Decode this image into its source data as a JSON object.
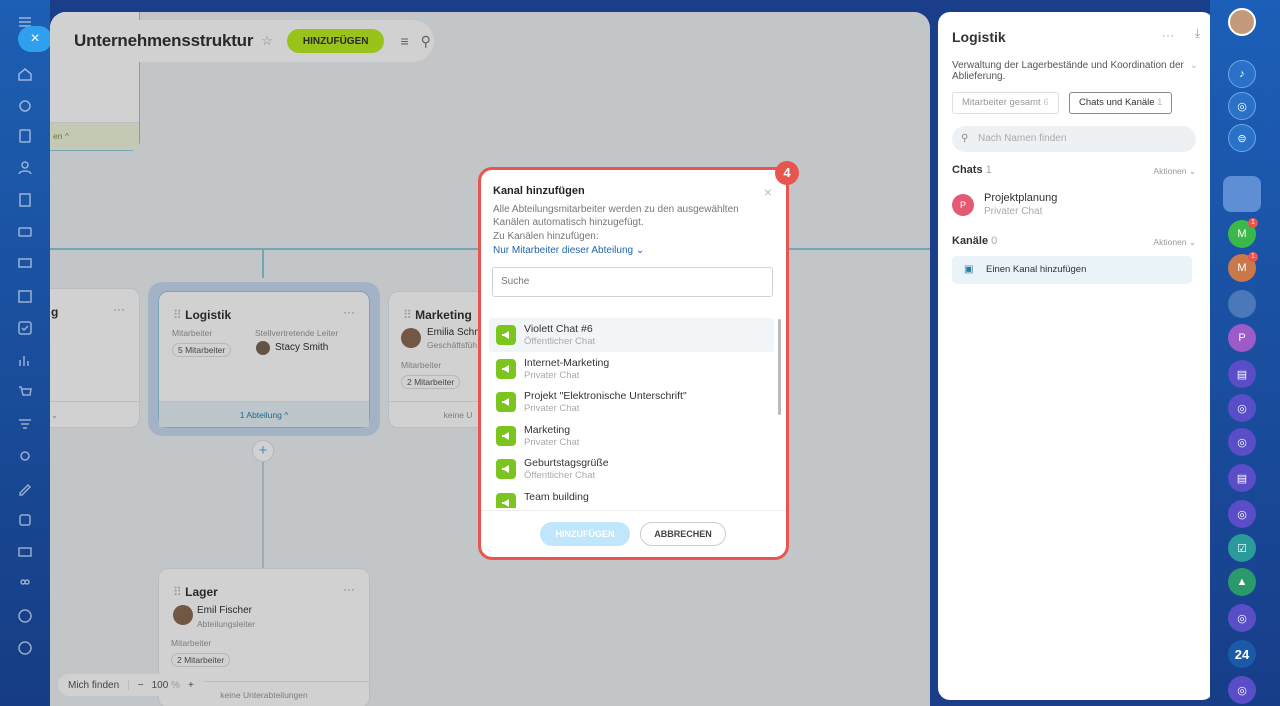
{
  "app": {
    "title": "Unternehmensstruktur",
    "add_button": "HINZUFÜGEN"
  },
  "cards": {
    "logistik": {
      "name": "Logistik",
      "label_staff": "Mitarbeiter",
      "label_deputy": "Stellvertretende Leiter",
      "staff_count": "5 Mitarbeiter",
      "deputy_name": "Stacy Smith",
      "footer": "1 Abteilung"
    },
    "marketing": {
      "name": "Marketing",
      "person": "Emilia Schm",
      "role": "Geschäftsfüh",
      "label_staff": "Mitarbeiter",
      "staff_count": "2 Mitarbeiter",
      "footer": "keine U"
    },
    "lager": {
      "name": "Lager",
      "person": "Emil Fischer",
      "role": "Abteilungsleiter",
      "label_staff": "Mitarbeiter",
      "staff_count": "2 Mitarbeiter",
      "footer": "keine Unterabteilungen"
    },
    "left_fragment_footer": "en",
    "left_card_name": "g"
  },
  "zoom": {
    "find_me": "Mich finden",
    "minus": "−",
    "value": "100",
    "unit": "%",
    "plus": "+"
  },
  "panel": {
    "title": "Logistik",
    "description": "Verwaltung der Lagerbestände und Koordination der Ablieferung.",
    "tab_staff": "Mitarbeiter gesamt",
    "tab_staff_count": "6",
    "tab_chats": "Chats und Kanäle",
    "tab_chats_count": "1",
    "search_placeholder": "Nach Namen finden",
    "chats_label": "Chats",
    "chats_count": "1",
    "actions": "Aktionen",
    "chat_name": "Projektplanung",
    "chat_type": "Privater Chat",
    "chat_avatar": "P",
    "channels_label": "Kanäle",
    "channels_count": "0",
    "add_channel": "Einen Kanal hinzufügen"
  },
  "modal": {
    "step_badge": "4",
    "title": "Kanal hinzufügen",
    "description": "Alle Abteilungsmitarbeiter werden zu den ausgewählten Kanälen automatisch hinzugefügt.",
    "add_to_label": "Zu Kanälen hinzufügen:",
    "scope_link": "Nur Mitarbeiter dieser Abteilung",
    "search_placeholder": "Suche",
    "items": [
      {
        "name": "Violett Chat #6",
        "type": "Öffentlicher Chat"
      },
      {
        "name": "Internet-Marketing",
        "type": "Privater Chat"
      },
      {
        "name": "Projekt \"Elektronische Unterschrift\"",
        "type": "Privater Chat"
      },
      {
        "name": "Marketing",
        "type": "Privater Chat"
      },
      {
        "name": "Geburtstagsgrüße",
        "type": "Öffentlicher Chat"
      },
      {
        "name": "Team building",
        "type": ""
      }
    ],
    "add_button": "HINZUFÜGEN",
    "cancel_button": "ABBRECHEN"
  },
  "right_bar": {
    "badge_m1": "M",
    "badge_m2": "M",
    "notify_1": "1",
    "notify_2": "1",
    "letter_p": "P",
    "b24": "24"
  },
  "colors": {
    "accent_green": "#bbed21",
    "highlight_red": "#e8554e",
    "chat_icon_green": "#7bc51e",
    "link_blue": "#2066b0"
  }
}
